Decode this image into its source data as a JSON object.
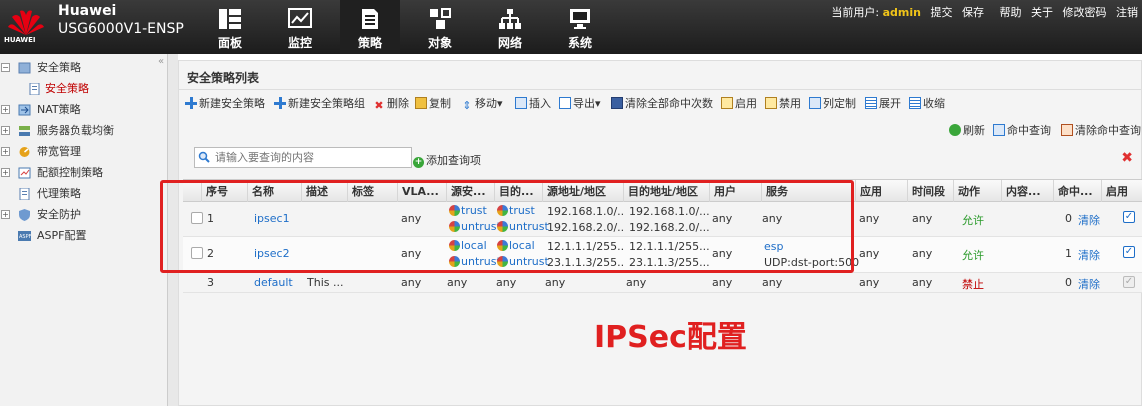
{
  "header": {
    "brand": "Huawei",
    "model": "USG6000V1-ENSP",
    "logo_text": "HUAWEI",
    "nav": [
      {
        "label": "面板",
        "icon": "dashboard-icon"
      },
      {
        "label": "监控",
        "icon": "monitor-icon"
      },
      {
        "label": "策略",
        "icon": "policy-icon"
      },
      {
        "label": "对象",
        "icon": "object-icon"
      },
      {
        "label": "网络",
        "icon": "network-icon"
      },
      {
        "label": "系统",
        "icon": "system-icon"
      }
    ],
    "current_user_label": "当前用户:",
    "current_user": "admin",
    "links": [
      "提交",
      "保存",
      "帮助",
      "关于",
      "修改密码",
      "注销"
    ]
  },
  "sidebar": {
    "collapse": "«",
    "items": [
      {
        "label": "安全策略",
        "expander": "−"
      },
      {
        "label": "安全策略",
        "selected": true
      },
      {
        "label": "NAT策略",
        "expander": "+"
      },
      {
        "label": "服务器负载均衡",
        "expander": "+"
      },
      {
        "label": "带宽管理",
        "expander": "+"
      },
      {
        "label": "配额控制策略",
        "expander": "+"
      },
      {
        "label": "代理策略"
      },
      {
        "label": "安全防护",
        "expander": "+"
      },
      {
        "label": "ASPF配置"
      }
    ]
  },
  "main": {
    "title": "安全策略列表",
    "toolbar": [
      "新建安全策略",
      "新建安全策略组",
      "删除",
      "复制",
      "移动▾",
      "插入",
      "导出▾",
      "清除全部命中次数",
      "启用",
      "禁用",
      "列定制",
      "展开",
      "收缩"
    ],
    "toolbar2": [
      "刷新",
      "命中查询",
      "清除命中查询"
    ],
    "search_placeholder": "请输入要查询的内容",
    "add_query": "添加查询项",
    "columns": [
      "序号",
      "名称",
      "描述",
      "标签",
      "VLA...",
      "源安...",
      "目的...",
      "源地址/地区",
      "目的地址/地区",
      "用户",
      "服务",
      "应用",
      "时间段",
      "动作",
      "内容...",
      "命中...",
      "启用"
    ],
    "rows": [
      {
        "no": "1",
        "name": "ipsec1",
        "desc": "",
        "vlan": "any",
        "src_zone": [
          "trust",
          "untrust"
        ],
        "dst_zone": [
          "trust",
          "untrust"
        ],
        "src_addr": [
          "192.168.1.0/...",
          "192.168.2.0/..."
        ],
        "dst_addr": [
          "192.168.1.0/...",
          "192.168.2.0/..."
        ],
        "user": "any",
        "service": [
          "any"
        ],
        "app": "any",
        "time": "any",
        "action": "允许",
        "hits": "0",
        "clear": "清除",
        "enabled": true
      },
      {
        "no": "2",
        "name": "ipsec2",
        "desc": "",
        "vlan": "any",
        "src_zone": [
          "local",
          "untrust"
        ],
        "dst_zone": [
          "local",
          "untrust"
        ],
        "src_addr": [
          "12.1.1.1/255....",
          "23.1.1.3/255...."
        ],
        "dst_addr": [
          "12.1.1.1/255....",
          "23.1.1.3/255...."
        ],
        "user": "any",
        "service": [
          "esp",
          "UDP:dst-port:500"
        ],
        "app": "any",
        "time": "any",
        "action": "允许",
        "hits": "1",
        "clear": "清除",
        "enabled": true
      },
      {
        "no": "3",
        "name": "default",
        "desc": "This ...",
        "vlan": "any",
        "src_zone": [
          "any"
        ],
        "dst_zone": [
          "any"
        ],
        "src_addr": [
          "any"
        ],
        "dst_addr": [
          "any"
        ],
        "user": "any",
        "service": [
          "any"
        ],
        "app": "any",
        "time": "any",
        "action": "禁止",
        "hits": "0",
        "clear": "清除",
        "enabled": true
      }
    ]
  },
  "annotation": "IPSec配置",
  "colors": {
    "accent_red": "#e02020",
    "link": "#1e6ec8",
    "allow": "#2a9a2a",
    "deny": "#c00000"
  }
}
